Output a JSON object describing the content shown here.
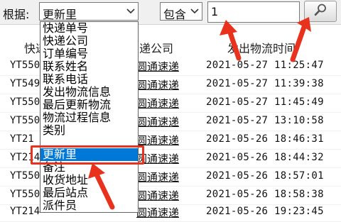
{
  "toolbar": {
    "basis_label": "根据:",
    "field_value": "更新里",
    "operator_value": "包含",
    "search_value": "1",
    "search_icon": "magnifier-icon"
  },
  "grid": {
    "headers": [
      "快递单号",
      "快递公司",
      "发出物流时间"
    ],
    "header_display": {
      "no": "快递",
      "co": "递公司",
      "time": "发出物流时间"
    },
    "rows": [
      {
        "no": "YT550",
        "co": "圆通速递",
        "time": "2021-05-27 11:25:47"
      },
      {
        "no": "YT549",
        "co": "圆通速递",
        "time": "2021-05-27 11:39:38"
      },
      {
        "no": "YT550",
        "co": "圆通速递",
        "time": "2021-05-27 11:45:49"
      },
      {
        "no": "YT550",
        "co": "圆通速递",
        "time": "2021-05-27 13:10:58"
      },
      {
        "no": "YT21",
        "co": "圆通速递",
        "time": "2021-05-26 18:46:31"
      },
      {
        "no": "YT214",
        "co": "圆通速递",
        "time": "2021-05-26 18:44:32"
      },
      {
        "no": "YT550",
        "co": "圆通速递",
        "time": "2021-05-26 18:57:01"
      },
      {
        "no": "YT550",
        "co": "圆通速递",
        "time": "2021-05-26 18:58:38"
      },
      {
        "no": "YT214",
        "co": "圆通速递",
        "time": "2021-05-26 19:23:45"
      }
    ]
  },
  "dropdown": {
    "items": [
      "快递单号",
      "快递公司",
      "订单编号",
      "联系姓名",
      "联系电话",
      "发出物流信息",
      "最后更新物流",
      "物流过程信息",
      "类别",
      "更新里",
      "备注",
      "收货地址",
      "最后站点",
      "派件员"
    ],
    "selected_index": 9
  },
  "colors": {
    "accent_selected": "#0078d7",
    "annotation_red": "#e8321e"
  }
}
